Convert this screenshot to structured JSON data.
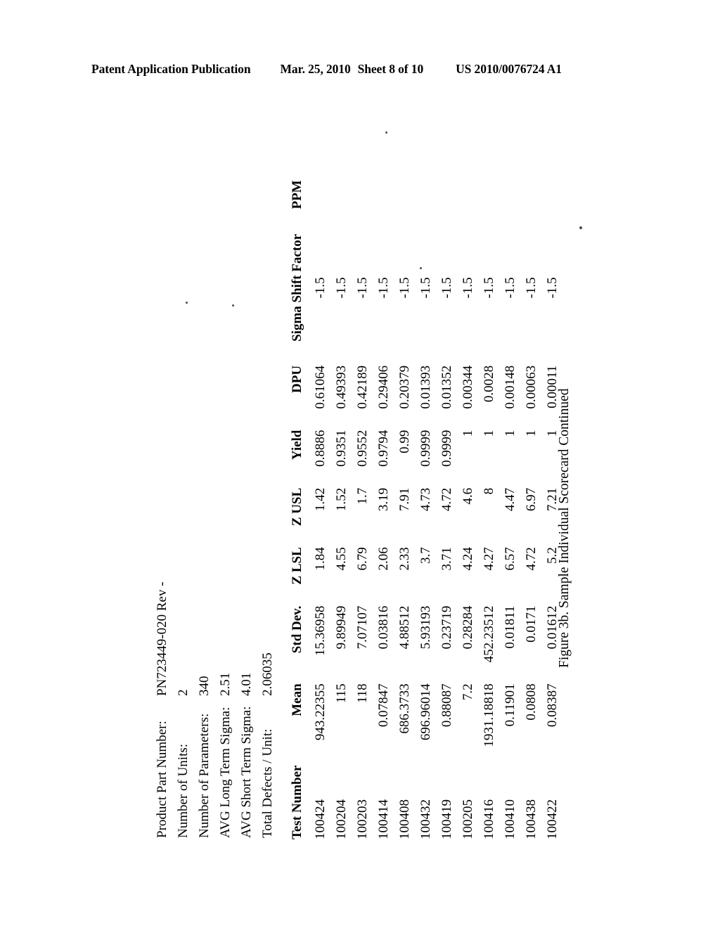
{
  "header": {
    "publication": "Patent Application Publication",
    "date": "Mar. 25, 2010",
    "sheet": "Sheet 8 of 10",
    "patent_number": "US 2010/0076724 A1"
  },
  "summary": {
    "rows": [
      {
        "label": "Product Part Number:",
        "value": "PN723449-020 Rev -"
      },
      {
        "label": "Number of Units:",
        "value": "2"
      },
      {
        "label": "Number of Parameters:",
        "value": "340"
      },
      {
        "label": "AVG Long Term Sigma:",
        "value": "2.51"
      },
      {
        "label": "AVG Short Term Sigma:",
        "value": "4.01"
      },
      {
        "label": "Total Defects / Unit:",
        "value": "2.06035"
      }
    ]
  },
  "table": {
    "columns": [
      "Test Number",
      "Mean",
      "Std Dev.",
      "Z LSL",
      "Z USL",
      "Yield",
      "DPU",
      "Sigma Shift Factor",
      "PPM"
    ],
    "rows": [
      {
        "test_number": "100424",
        "mean": "943.22355",
        "std_dev": "15.36958",
        "z_lsl": "1.84",
        "z_usl": "1.42",
        "yield": "0.8886",
        "dpu": "0.61064",
        "sigma_shift_factor": "-1.5",
        "ppm": ""
      },
      {
        "test_number": "100204",
        "mean": "115",
        "std_dev": "9.89949",
        "z_lsl": "4.55",
        "z_usl": "1.52",
        "yield": "0.9351",
        "dpu": "0.49393",
        "sigma_shift_factor": "-1.5",
        "ppm": ""
      },
      {
        "test_number": "100203",
        "mean": "118",
        "std_dev": "7.07107",
        "z_lsl": "6.79",
        "z_usl": "1.7",
        "yield": "0.9552",
        "dpu": "0.42189",
        "sigma_shift_factor": "-1.5",
        "ppm": ""
      },
      {
        "test_number": "100414",
        "mean": "0.07847",
        "std_dev": "0.03816",
        "z_lsl": "2.06",
        "z_usl": "3.19",
        "yield": "0.9794",
        "dpu": "0.29406",
        "sigma_shift_factor": "-1.5",
        "ppm": ""
      },
      {
        "test_number": "100408",
        "mean": "686.3733",
        "std_dev": "4.88512",
        "z_lsl": "2.33",
        "z_usl": "7.91",
        "yield": "0.99",
        "dpu": "0.20379",
        "sigma_shift_factor": "-1.5",
        "ppm": ""
      },
      {
        "test_number": "100432",
        "mean": "696.96014",
        "std_dev": "5.93193",
        "z_lsl": "3.7",
        "z_usl": "4.73",
        "yield": "0.9999",
        "dpu": "0.01393",
        "sigma_shift_factor": "-1.5",
        "ppm": ""
      },
      {
        "test_number": "100419",
        "mean": "0.88087",
        "std_dev": "0.23719",
        "z_lsl": "3.71",
        "z_usl": "4.72",
        "yield": "0.9999",
        "dpu": "0.01352",
        "sigma_shift_factor": "-1.5",
        "ppm": ""
      },
      {
        "test_number": "100205",
        "mean": "7.2",
        "std_dev": "0.28284",
        "z_lsl": "4.24",
        "z_usl": "4.6",
        "yield": "1",
        "dpu": "0.00344",
        "sigma_shift_factor": "-1.5",
        "ppm": ""
      },
      {
        "test_number": "100416",
        "mean": "1931.18818",
        "std_dev": "452.23512",
        "z_lsl": "4.27",
        "z_usl": "8",
        "yield": "1",
        "dpu": "0.0028",
        "sigma_shift_factor": "-1.5",
        "ppm": ""
      },
      {
        "test_number": "100410",
        "mean": "0.11901",
        "std_dev": "0.01811",
        "z_lsl": "6.57",
        "z_usl": "4.47",
        "yield": "1",
        "dpu": "0.00148",
        "sigma_shift_factor": "-1.5",
        "ppm": ""
      },
      {
        "test_number": "100438",
        "mean": "0.0808",
        "std_dev": "0.0171",
        "z_lsl": "4.72",
        "z_usl": "6.97",
        "yield": "1",
        "dpu": "0.00063",
        "sigma_shift_factor": "-1.5",
        "ppm": ""
      },
      {
        "test_number": "100422",
        "mean": "0.08387",
        "std_dev": "0.01612",
        "z_lsl": "5.2",
        "z_usl": "7.21",
        "yield": "1",
        "dpu": "0.00011",
        "sigma_shift_factor": "-1.5",
        "ppm": ""
      }
    ]
  },
  "figure": {
    "caption": "Figure 3b. Sample Individual Scorecard Continued"
  }
}
